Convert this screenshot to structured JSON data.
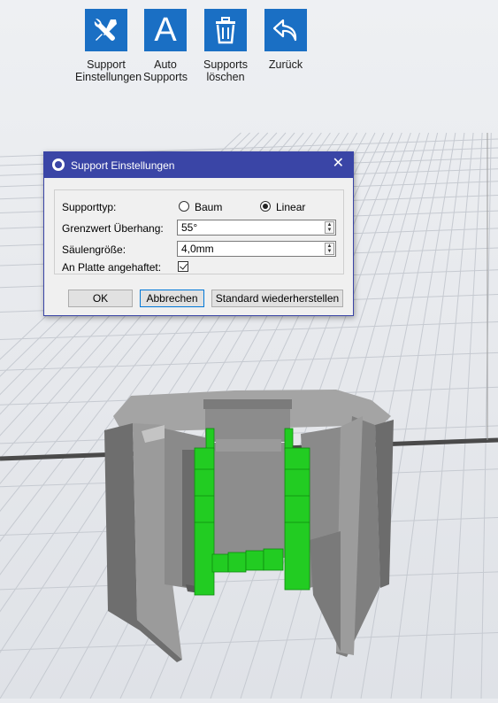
{
  "toolbar": {
    "items": [
      {
        "label": "Support\nEinstellungen",
        "icon": "tools-icon"
      },
      {
        "label": "Auto\nSupports",
        "icon": "auto-supports-icon",
        "glyph": "A"
      },
      {
        "label": "Supports\nlöschen",
        "icon": "trash-icon"
      },
      {
        "label": "Zurück",
        "icon": "back-arrow-icon"
      }
    ],
    "accent": "#1a6fc4"
  },
  "dialog": {
    "title": "Support Einstellungen",
    "close_glyph": "✕",
    "supporttyp_label": "Supporttyp:",
    "option_baum": "Baum",
    "option_linear": "Linear",
    "selected_type": "Linear",
    "grenzwert_label": "Grenzwert Überhang:",
    "grenzwert_value": "55°",
    "saeulengroesse_label": "Säulengröße:",
    "saeulengroesse_value": "4,0mm",
    "platte_label": "An Platte angehaftet:",
    "platte_checked": true,
    "ok_label": "OK",
    "cancel_label": "Abbrechen",
    "reset_label": "Standard wiederherstellen",
    "titlebar_color": "#3a45a6"
  },
  "scene": {
    "model_color": "#8a8a8a",
    "support_color": "#22cc22",
    "grid_color": "#c9ccd2"
  }
}
